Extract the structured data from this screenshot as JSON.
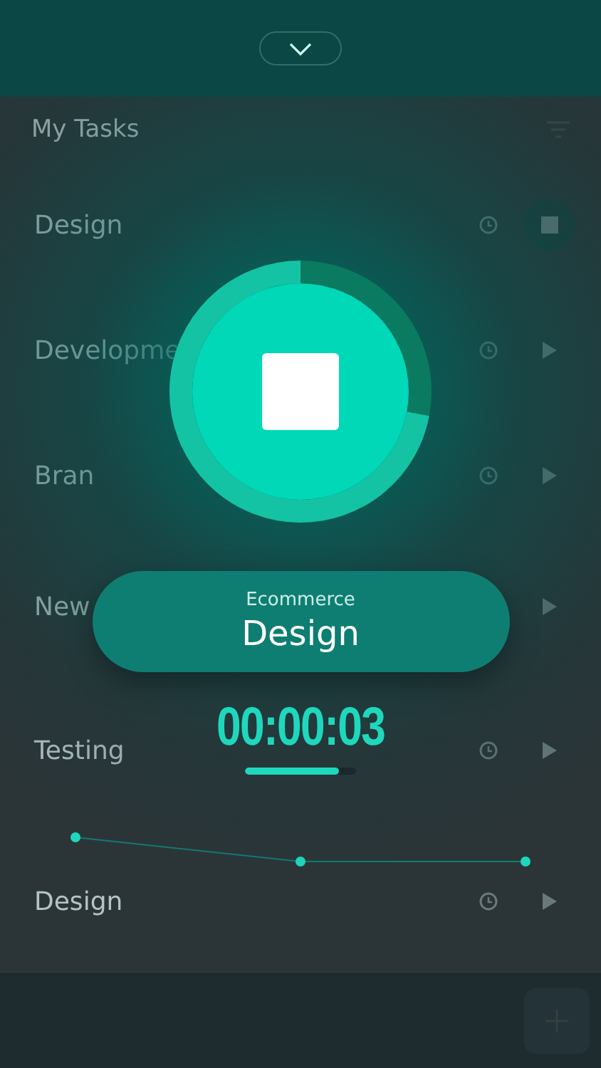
{
  "list": {
    "title": "My Tasks",
    "rows": [
      {
        "title": "Design",
        "kind": "running"
      },
      {
        "title": "Developme",
        "kind": "idle"
      },
      {
        "title": "Bran",
        "kind": "idle"
      },
      {
        "title": "New",
        "kind": "idle"
      },
      {
        "title": "Testing",
        "kind": "idle"
      },
      {
        "title": "Design",
        "kind": "idle"
      }
    ]
  },
  "timer_overlay": {
    "ring": {
      "level": 0.72
    },
    "category": "Ecommerce",
    "task": "Design",
    "elapsed": "00:00:03",
    "progress": {
      "level": 0.84
    }
  }
}
